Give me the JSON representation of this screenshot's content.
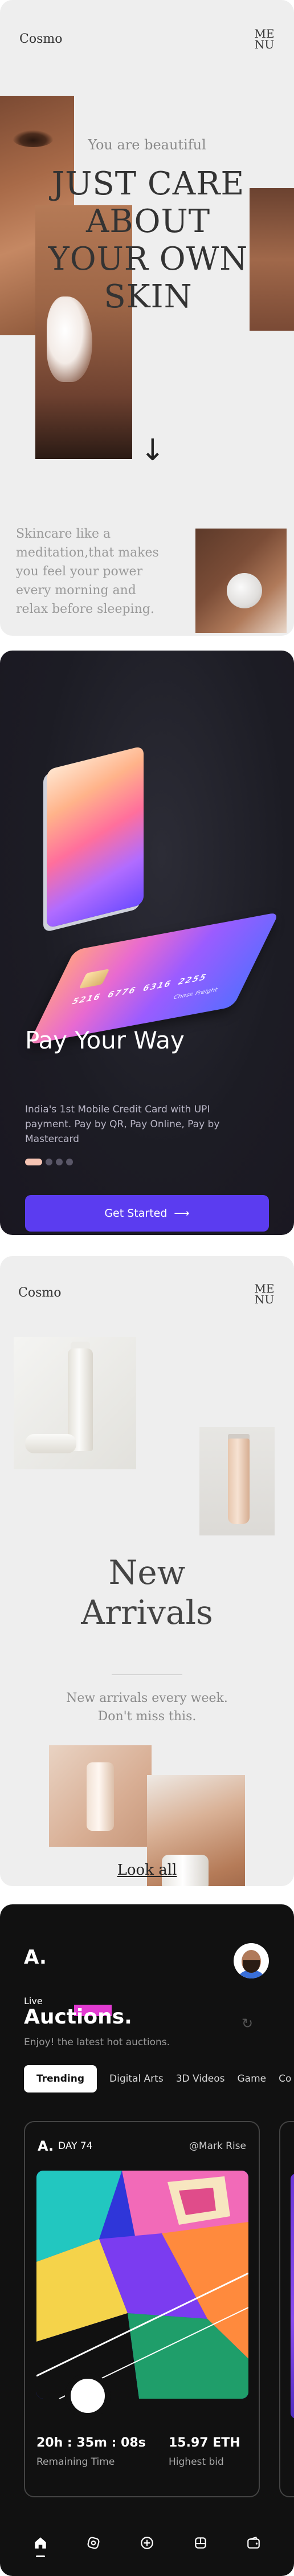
{
  "cosmo": {
    "brand": "Cosmo",
    "menu_label": "ME\nNU",
    "tagline": "You are beautiful",
    "headline": "JUST CARE ABOUT YOUR OWN SKIN",
    "copy": "Skincare like a meditation,that makes you feel your power every morning and relax before sleeping.",
    "arrow": "↓"
  },
  "card_app": {
    "card_number": "5216 6776 6316 2255",
    "card_holder": "Chase Freight",
    "title": "Pay Your Way",
    "description": "India's 1st Mobile Credit Card with UPI payment. Pay by QR, Pay Online, Pay by Mastercard",
    "pager": {
      "count": 4,
      "active": 0
    },
    "cta_label": "Get Started",
    "cta_arrow": "⟶",
    "colors": {
      "background": "#1c1c24",
      "cta": "#5b3cf0"
    }
  },
  "arrivals": {
    "brand": "Cosmo",
    "menu_label": "ME\nNU",
    "title": "New\nArrivals",
    "subtitle": "New arrivals every week.\nDon't miss this.",
    "link_label": "Look all"
  },
  "auctions": {
    "logo": "A.",
    "live_label": "Live",
    "title": "Auctions.",
    "intro": "Enjoy! the latest hot auctions.",
    "tabs": [
      {
        "label": "Trending",
        "active": true
      },
      {
        "label": "Digital Arts",
        "active": false
      },
      {
        "label": "3D Videos",
        "active": false
      },
      {
        "label": "Game",
        "active": false
      },
      {
        "label": "Co",
        "active": false
      }
    ],
    "card": {
      "mark": "A.",
      "day": "DAY 74",
      "author": "@Mark Rise",
      "time_left": "20h : 35m : 08s",
      "time_label": "Remaining Time",
      "highest_bid": "15.97 ETH",
      "bid_label": "Highest bid"
    },
    "nav": [
      "home-icon",
      "discover-icon",
      "add-icon",
      "collection-icon",
      "wallet-icon"
    ],
    "colors": {
      "background": "#111111",
      "highlight": "#e23bd1"
    }
  }
}
